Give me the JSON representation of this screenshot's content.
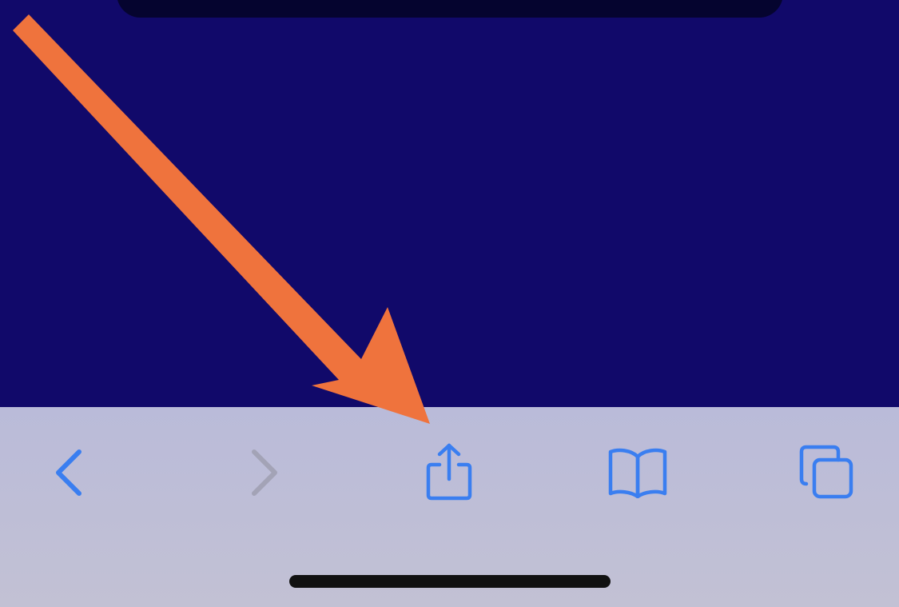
{
  "browser": {
    "content_color": "#11096a",
    "toolbar_color": "#bcbcd8",
    "accent_color": "#3a7ef0",
    "disabled_color": "#a3a3b6"
  },
  "toolbar": {
    "buttons": [
      {
        "id": "back",
        "icon": "chevron-left-icon",
        "enabled": true
      },
      {
        "id": "forward",
        "icon": "chevron-right-icon",
        "enabled": false
      },
      {
        "id": "share",
        "icon": "share-icon",
        "enabled": true,
        "highlighted": true
      },
      {
        "id": "bookmarks",
        "icon": "book-icon",
        "enabled": true
      },
      {
        "id": "tabs",
        "icon": "tabs-icon",
        "enabled": true
      }
    ]
  },
  "annotation": {
    "type": "arrow",
    "color": "#ef733d",
    "points_to": "share-button"
  }
}
